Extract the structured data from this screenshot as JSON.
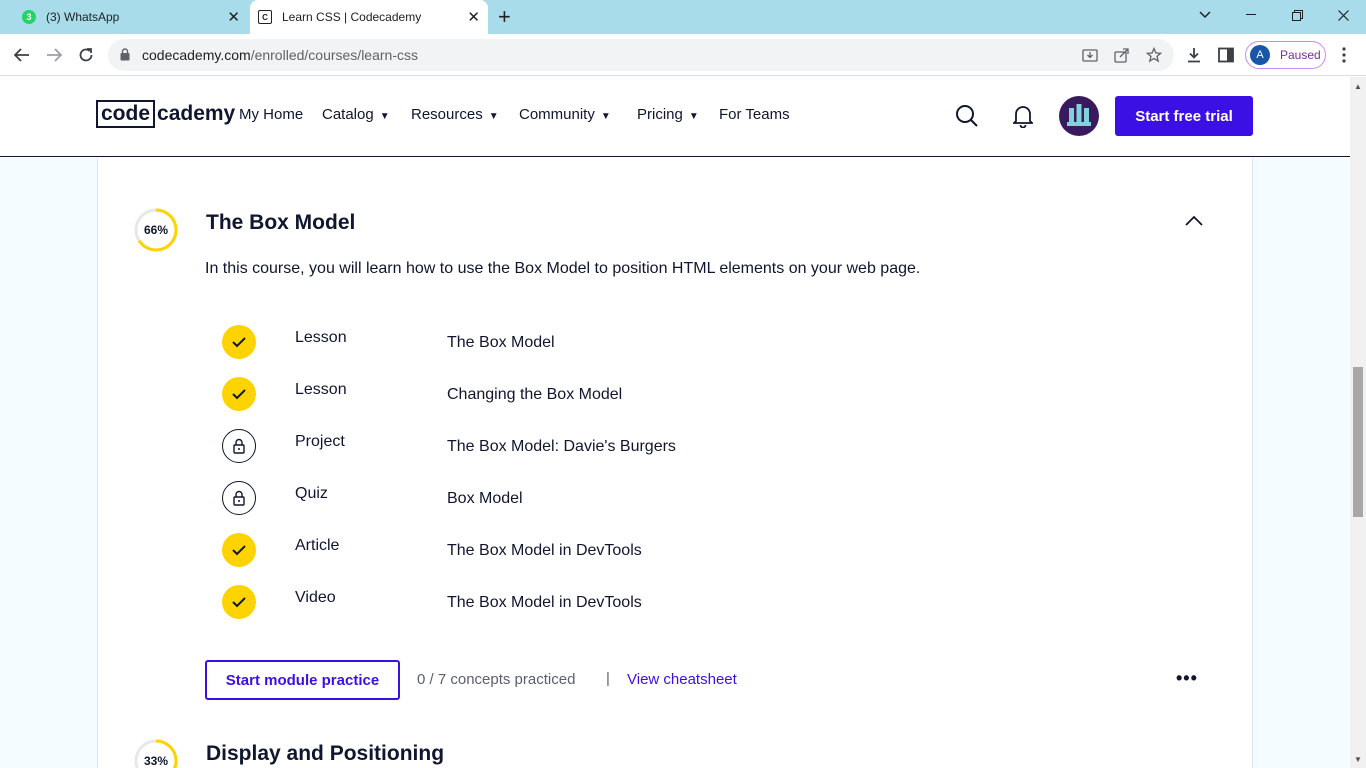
{
  "browser": {
    "tabs": [
      {
        "title": "(3) WhatsApp",
        "badge": "3"
      },
      {
        "title": "Learn CSS | Codecademy",
        "favicon_text": "C"
      }
    ],
    "url_host": "codecademy.com",
    "url_path": "/enrolled/courses/learn-css",
    "profile_initial": "A",
    "profile_status": "Paused"
  },
  "navbar": {
    "logo_code": "code",
    "logo_cademy": "cademy",
    "items": [
      {
        "label": "My Home"
      },
      {
        "label": "Catalog"
      },
      {
        "label": "Resources"
      },
      {
        "label": "Community"
      },
      {
        "label": "Pricing"
      },
      {
        "label": "For Teams"
      }
    ],
    "cta_label": "Start free trial"
  },
  "module": {
    "progress_label": "66%",
    "progress_fraction": 0.66,
    "title": "The Box Model",
    "description": "In this course, you will learn how to use the Box Model to position HTML elements on your web page.",
    "items": [
      {
        "type": "Lesson",
        "title": "The Box Model",
        "status": "completed"
      },
      {
        "type": "Lesson",
        "title": "Changing the Box Model",
        "status": "completed"
      },
      {
        "type": "Project",
        "title": "The Box Model: Davie's Burgers",
        "status": "locked"
      },
      {
        "type": "Quiz",
        "title": "Box Model",
        "status": "locked"
      },
      {
        "type": "Article",
        "title": "The Box Model in DevTools",
        "status": "completed"
      },
      {
        "type": "Video",
        "title": "The Box Model in DevTools",
        "status": "completed"
      }
    ],
    "practice_button": "Start module practice",
    "concepts_text": "0 / 7 concepts practiced",
    "separator": "|",
    "cheatsheet_link": "View cheatsheet"
  },
  "next_module": {
    "progress_label": "33%",
    "progress_fraction": 0.33,
    "title": "Display and Positioning"
  },
  "colors": {
    "accent": "#3a10e5",
    "progress_yellow": "#ffd300",
    "navy": "#10162f"
  }
}
